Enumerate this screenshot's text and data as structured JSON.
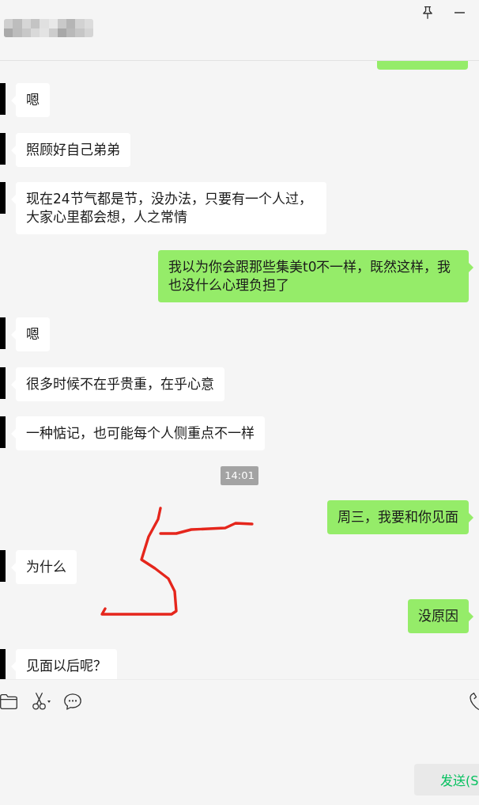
{
  "messages": [
    {
      "kind": "clipped",
      "outgoing": true
    },
    {
      "kind": "text",
      "outgoing": false,
      "text": "嗯"
    },
    {
      "kind": "text",
      "outgoing": false,
      "text": "照顾好自己弟弟"
    },
    {
      "kind": "text",
      "outgoing": false,
      "text": "现在24节气都是节，没办法，只要有一个人过，大家心里都会想，人之常情"
    },
    {
      "kind": "text",
      "outgoing": true,
      "text": "我以为你会跟那些集美t0不一样，既然这样，我也没什么心理负担了"
    },
    {
      "kind": "text",
      "outgoing": false,
      "text": "嗯"
    },
    {
      "kind": "text",
      "outgoing": false,
      "text": "很多时候不在乎贵重，在乎心意"
    },
    {
      "kind": "text",
      "outgoing": false,
      "text": "一种惦记，也可能每个人侧重点不一样"
    },
    {
      "kind": "time",
      "text": "14:01"
    },
    {
      "kind": "text",
      "outgoing": true,
      "text": "周三，我要和你见面"
    },
    {
      "kind": "text",
      "outgoing": false,
      "text": "为什么"
    },
    {
      "kind": "text",
      "outgoing": true,
      "text": "没原因"
    },
    {
      "kind": "text",
      "outgoing": false,
      "text": "见面以后呢？"
    }
  ],
  "composer": {
    "send_button": "发送(S"
  }
}
